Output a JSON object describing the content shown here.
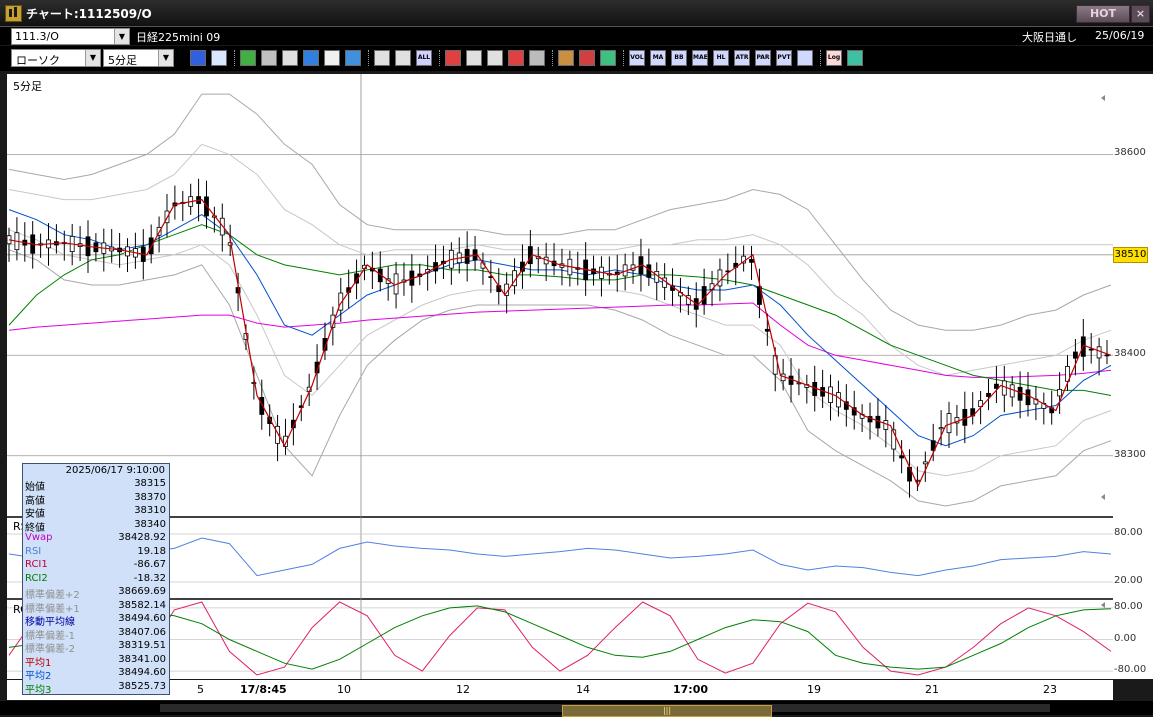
{
  "window": {
    "title": "チャート:1112509/O",
    "hot_label": "HOT",
    "close_label": "×"
  },
  "symbol_bar": {
    "symbol_code": "111.3/O",
    "symbol_name": "日経225mini 09",
    "market": "大阪日通し",
    "date": "25/06/19"
  },
  "toolbar": {
    "chart_type": "ローソク",
    "timeframe": "5分足",
    "buttons": [
      {
        "name": "zoom-icon",
        "label": "",
        "color": "#3060e0",
        "gap": false
      },
      {
        "name": "window-icon",
        "label": "",
        "color": "#d8e8ff",
        "gap": false
      },
      {
        "name": "pencil-icon",
        "label": "",
        "color": "#40b040",
        "gap": true
      },
      {
        "name": "link-icon",
        "label": "",
        "color": "#c0c0c0",
        "gap": false
      },
      {
        "name": "cursor-icon",
        "label": "",
        "color": "#e0e0e0",
        "gap": false
      },
      {
        "name": "refresh-icon",
        "label": "",
        "color": "#3080e0",
        "gap": false
      },
      {
        "name": "document-icon",
        "label": "",
        "color": "#f0f0f0",
        "gap": false
      },
      {
        "name": "trash-icon",
        "label": "",
        "color": "#4090e0",
        "gap": false
      },
      {
        "name": "candle-icon",
        "label": "",
        "color": "#e0e0e0",
        "gap": true
      },
      {
        "name": "candle-move-icon",
        "label": "",
        "color": "#e0e0e0",
        "gap": false
      },
      {
        "name": "all-icon",
        "label": "ALL",
        "color": "#d0d0ff",
        "gap": false
      },
      {
        "name": "compare-icon",
        "label": "",
        "color": "#e04040",
        "gap": true
      },
      {
        "name": "search-chart-icon",
        "label": "",
        "color": "#e0e0e0",
        "gap": false
      },
      {
        "name": "area-icon",
        "label": "",
        "color": "#e0e0e0",
        "gap": false
      },
      {
        "name": "swap-icon",
        "label": "",
        "color": "#e04040",
        "gap": false
      },
      {
        "name": "disabled-icon",
        "label": "",
        "color": "#bbbbbb",
        "gap": false
      },
      {
        "name": "grid-icon",
        "label": "",
        "color": "#c89040",
        "gap": true
      },
      {
        "name": "tools-icon",
        "label": "",
        "color": "#d04040",
        "gap": false
      },
      {
        "name": "palette-icon",
        "label": "",
        "color": "#40c080",
        "gap": false
      },
      {
        "name": "vol-icon",
        "label": "VOL",
        "color": "#d0d8ff",
        "gap": true
      },
      {
        "name": "ma-icon",
        "label": "MA",
        "color": "#d0d8ff",
        "gap": false
      },
      {
        "name": "bb-icon",
        "label": "BB",
        "color": "#d0d8ff",
        "gap": false
      },
      {
        "name": "mae-icon",
        "label": "MAE",
        "color": "#d0d8ff",
        "gap": false
      },
      {
        "name": "hl-icon",
        "label": "HL",
        "color": "#d0d8ff",
        "gap": false
      },
      {
        "name": "atr-icon",
        "label": "ATR",
        "color": "#d0d8ff",
        "gap": false
      },
      {
        "name": "para-icon",
        "label": "PAR",
        "color": "#d0d8ff",
        "gap": false
      },
      {
        "name": "pvt-icon",
        "label": "PVT",
        "color": "#d0d8ff",
        "gap": false
      },
      {
        "name": "box-icon",
        "label": "",
        "color": "#d0d8ff",
        "gap": false
      },
      {
        "name": "log-icon",
        "label": "Log",
        "color": "#ffd8d8",
        "gap": true
      },
      {
        "name": "export-icon",
        "label": "",
        "color": "#40c0a0",
        "gap": false
      }
    ]
  },
  "panes": {
    "main": "5分足",
    "rsi": "RSI",
    "rci": "RCI"
  },
  "price_axis": [
    {
      "label": "38600",
      "value": 38600
    },
    {
      "label": "38500",
      "value": 38500
    },
    {
      "label": "38400",
      "value": 38400
    },
    {
      "label": "38300",
      "value": 38300
    }
  ],
  "current_price": {
    "label": "38510",
    "value": 38510
  },
  "rsi_axis": [
    {
      "label": "80.00",
      "value": 80
    },
    {
      "label": "20.00",
      "value": 20
    }
  ],
  "rci_axis": [
    {
      "label": "80.00",
      "value": 80
    },
    {
      "label": "0.00",
      "value": 0
    },
    {
      "label": "-80.00",
      "value": -80
    }
  ],
  "time_axis": [
    {
      "label": "5",
      "bold": false
    },
    {
      "label": "17/8:45",
      "bold": true
    },
    {
      "label": "10",
      "bold": false
    },
    {
      "label": "12",
      "bold": false
    },
    {
      "label": "14",
      "bold": false
    },
    {
      "label": "17:00",
      "bold": true
    },
    {
      "label": "19",
      "bold": false
    },
    {
      "label": "21",
      "bold": false
    },
    {
      "label": "23",
      "bold": false
    }
  ],
  "data_window": {
    "timestamp": "2025/06/17 9:10:00",
    "rows": [
      {
        "label": "始値",
        "value": "38315",
        "color": "#000000"
      },
      {
        "label": "高値",
        "value": "38370",
        "color": "#000000"
      },
      {
        "label": "安値",
        "value": "38310",
        "color": "#000000"
      },
      {
        "label": "終値",
        "value": "38340",
        "color": "#000000"
      },
      {
        "label": "Vwap",
        "value": "38428.92",
        "color": "#c000c0"
      },
      {
        "label": "RSI",
        "value": "19.18",
        "color": "#4a80d0"
      },
      {
        "label": "RCI1",
        "value": "-86.67",
        "color": "#c00040"
      },
      {
        "label": "RCI2",
        "value": "-18.32",
        "color": "#008000"
      },
      {
        "label": "標準偏差+2",
        "value": "38669.69",
        "color": "#909090"
      },
      {
        "label": "標準偏差+1",
        "value": "38582.14",
        "color": "#909090"
      },
      {
        "label": "移動平均線",
        "value": "38494.60",
        "color": "#0000a0"
      },
      {
        "label": "標準偏差-1",
        "value": "38407.06",
        "color": "#909090"
      },
      {
        "label": "標準偏差-2",
        "value": "38319.51",
        "color": "#909090"
      },
      {
        "label": "平均1",
        "value": "38341.00",
        "color": "#c00000"
      },
      {
        "label": "平均2",
        "value": "38494.60",
        "color": "#0050d0"
      },
      {
        "label": "平均3",
        "value": "38525.73",
        "color": "#008000"
      }
    ]
  },
  "chart_data": {
    "type": "line",
    "main": {
      "ylim": [
        38240,
        38680
      ],
      "x": [
        0,
        5,
        10,
        15,
        20,
        25,
        30,
        35,
        40,
        45,
        50,
        55,
        60,
        65,
        70,
        75,
        80,
        85,
        90,
        95,
        100,
        105,
        110,
        115,
        120,
        125,
        130,
        135,
        140,
        145,
        150,
        155,
        160,
        165,
        170,
        175,
        180,
        185,
        190,
        195,
        200
      ],
      "series": [
        {
          "color": "#c00000",
          "values": [
            38515,
            38510,
            38512,
            38508,
            38505,
            38500,
            38550,
            38555,
            38520,
            38360,
            38310,
            38370,
            38450,
            38490,
            38470,
            38480,
            38495,
            38500,
            38460,
            38500,
            38490,
            38485,
            38480,
            38490,
            38470,
            38450,
            38480,
            38500,
            38380,
            38370,
            38360,
            38340,
            38330,
            38270,
            38330,
            38340,
            38370,
            38360,
            38345,
            38410,
            38400
          ]
        },
        {
          "color": "#0050d0",
          "values": [
            38545,
            38535,
            38520,
            38515,
            38505,
            38510,
            38525,
            38540,
            38520,
            38480,
            38430,
            38420,
            38440,
            38460,
            38470,
            38480,
            38490,
            38495,
            38490,
            38485,
            38485,
            38480,
            38485,
            38480,
            38470,
            38465,
            38465,
            38470,
            38450,
            38420,
            38395,
            38370,
            38345,
            38320,
            38310,
            38320,
            38340,
            38345,
            38350,
            38375,
            38390
          ]
        },
        {
          "color": "#008000",
          "values": [
            38430,
            38460,
            38480,
            38495,
            38500,
            38510,
            38520,
            38530,
            38520,
            38500,
            38490,
            38485,
            38480,
            38485,
            38490,
            38490,
            38485,
            38485,
            38480,
            38480,
            38478,
            38475,
            38475,
            38480,
            38480,
            38478,
            38475,
            38470,
            38460,
            38450,
            38440,
            38425,
            38410,
            38400,
            38390,
            38380,
            38375,
            38370,
            38365,
            38365,
            38360
          ]
        },
        {
          "color": "#e000e0",
          "values": [
            38425,
            38428,
            38430,
            38432,
            38434,
            38436,
            38438,
            38440,
            38440,
            38432,
            38428,
            38430,
            38432,
            38435,
            38437,
            38439,
            38441,
            38443,
            38444,
            38445,
            38446,
            38447,
            38448,
            38449,
            38450,
            38450,
            38451,
            38452,
            38430,
            38410,
            38400,
            38395,
            38390,
            38385,
            38380,
            38378,
            38378,
            38379,
            38380,
            38382,
            38385
          ]
        },
        {
          "color": "#a8a8a8",
          "values": [
            38585,
            38580,
            38575,
            38580,
            38590,
            38600,
            38620,
            38660,
            38660,
            38640,
            38610,
            38590,
            38550,
            38530,
            38525,
            38525,
            38525,
            38525,
            38520,
            38520,
            38520,
            38525,
            38525,
            38535,
            38545,
            38550,
            38555,
            38565,
            38560,
            38545,
            38510,
            38475,
            38445,
            38430,
            38425,
            38425,
            38430,
            38440,
            38445,
            38460,
            38470
          ]
        },
        {
          "color": "#a8a8a8",
          "values": [
            38505,
            38495,
            38475,
            38470,
            38470,
            38475,
            38480,
            38490,
            38450,
            38380,
            38310,
            38280,
            38340,
            38390,
            38415,
            38435,
            38445,
            38450,
            38450,
            38450,
            38450,
            38450,
            38445,
            38435,
            38420,
            38410,
            38400,
            38400,
            38375,
            38325,
            38305,
            38290,
            38275,
            38255,
            38250,
            38255,
            38270,
            38275,
            38280,
            38305,
            38315
          ]
        },
        {
          "color": "#c8c8c8",
          "values": [
            38565,
            38560,
            38555,
            38555,
            38560,
            38565,
            38580,
            38610,
            38600,
            38580,
            38545,
            38530,
            38510,
            38500,
            38505,
            38505,
            38505,
            38510,
            38505,
            38505,
            38505,
            38505,
            38505,
            38510,
            38510,
            38515,
            38515,
            38520,
            38510,
            38490,
            38460,
            38440,
            38410,
            38390,
            38380,
            38385,
            38390,
            38395,
            38400,
            38415,
            38425
          ]
        },
        {
          "color": "#c8c8c8",
          "values": [
            38525,
            38515,
            38500,
            38495,
            38490,
            38495,
            38500,
            38510,
            38490,
            38440,
            38380,
            38360,
            38390,
            38420,
            38435,
            38450,
            38460,
            38465,
            38465,
            38465,
            38465,
            38465,
            38465,
            38460,
            38450,
            38440,
            38430,
            38430,
            38410,
            38365,
            38345,
            38330,
            38310,
            38285,
            38280,
            38285,
            38300,
            38305,
            38310,
            38335,
            38345
          ]
        }
      ]
    },
    "rsi": {
      "ylim": [
        0,
        100
      ],
      "values": [
        55,
        50,
        60,
        55,
        52,
        58,
        62,
        75,
        68,
        28,
        35,
        42,
        62,
        70,
        65,
        62,
        60,
        55,
        52,
        55,
        58,
        62,
        60,
        55,
        50,
        52,
        55,
        60,
        42,
        35,
        40,
        38,
        32,
        28,
        35,
        40,
        48,
        50,
        52,
        58,
        55
      ]
    },
    "rci": {
      "ylim": [
        -100,
        100
      ],
      "series": [
        {
          "color": "#e0206a",
          "values": [
            -40,
            60,
            95,
            20,
            -60,
            -40,
            75,
            95,
            -30,
            -90,
            -70,
            30,
            95,
            60,
            -40,
            -80,
            10,
            80,
            75,
            -20,
            -80,
            -40,
            30,
            95,
            60,
            -50,
            -85,
            -60,
            40,
            92,
            70,
            -20,
            -80,
            -90,
            -70,
            -20,
            40,
            80,
            60,
            20,
            -30
          ]
        },
        {
          "color": "#008000",
          "values": [
            -20,
            -10,
            10,
            30,
            50,
            70,
            60,
            40,
            0,
            -30,
            -60,
            -75,
            -50,
            -10,
            30,
            60,
            80,
            85,
            70,
            40,
            10,
            -20,
            -40,
            -45,
            -30,
            0,
            30,
            50,
            45,
            20,
            -40,
            -60,
            -70,
            -75,
            -70,
            -40,
            -10,
            30,
            60,
            75,
            78
          ]
        }
      ]
    }
  }
}
